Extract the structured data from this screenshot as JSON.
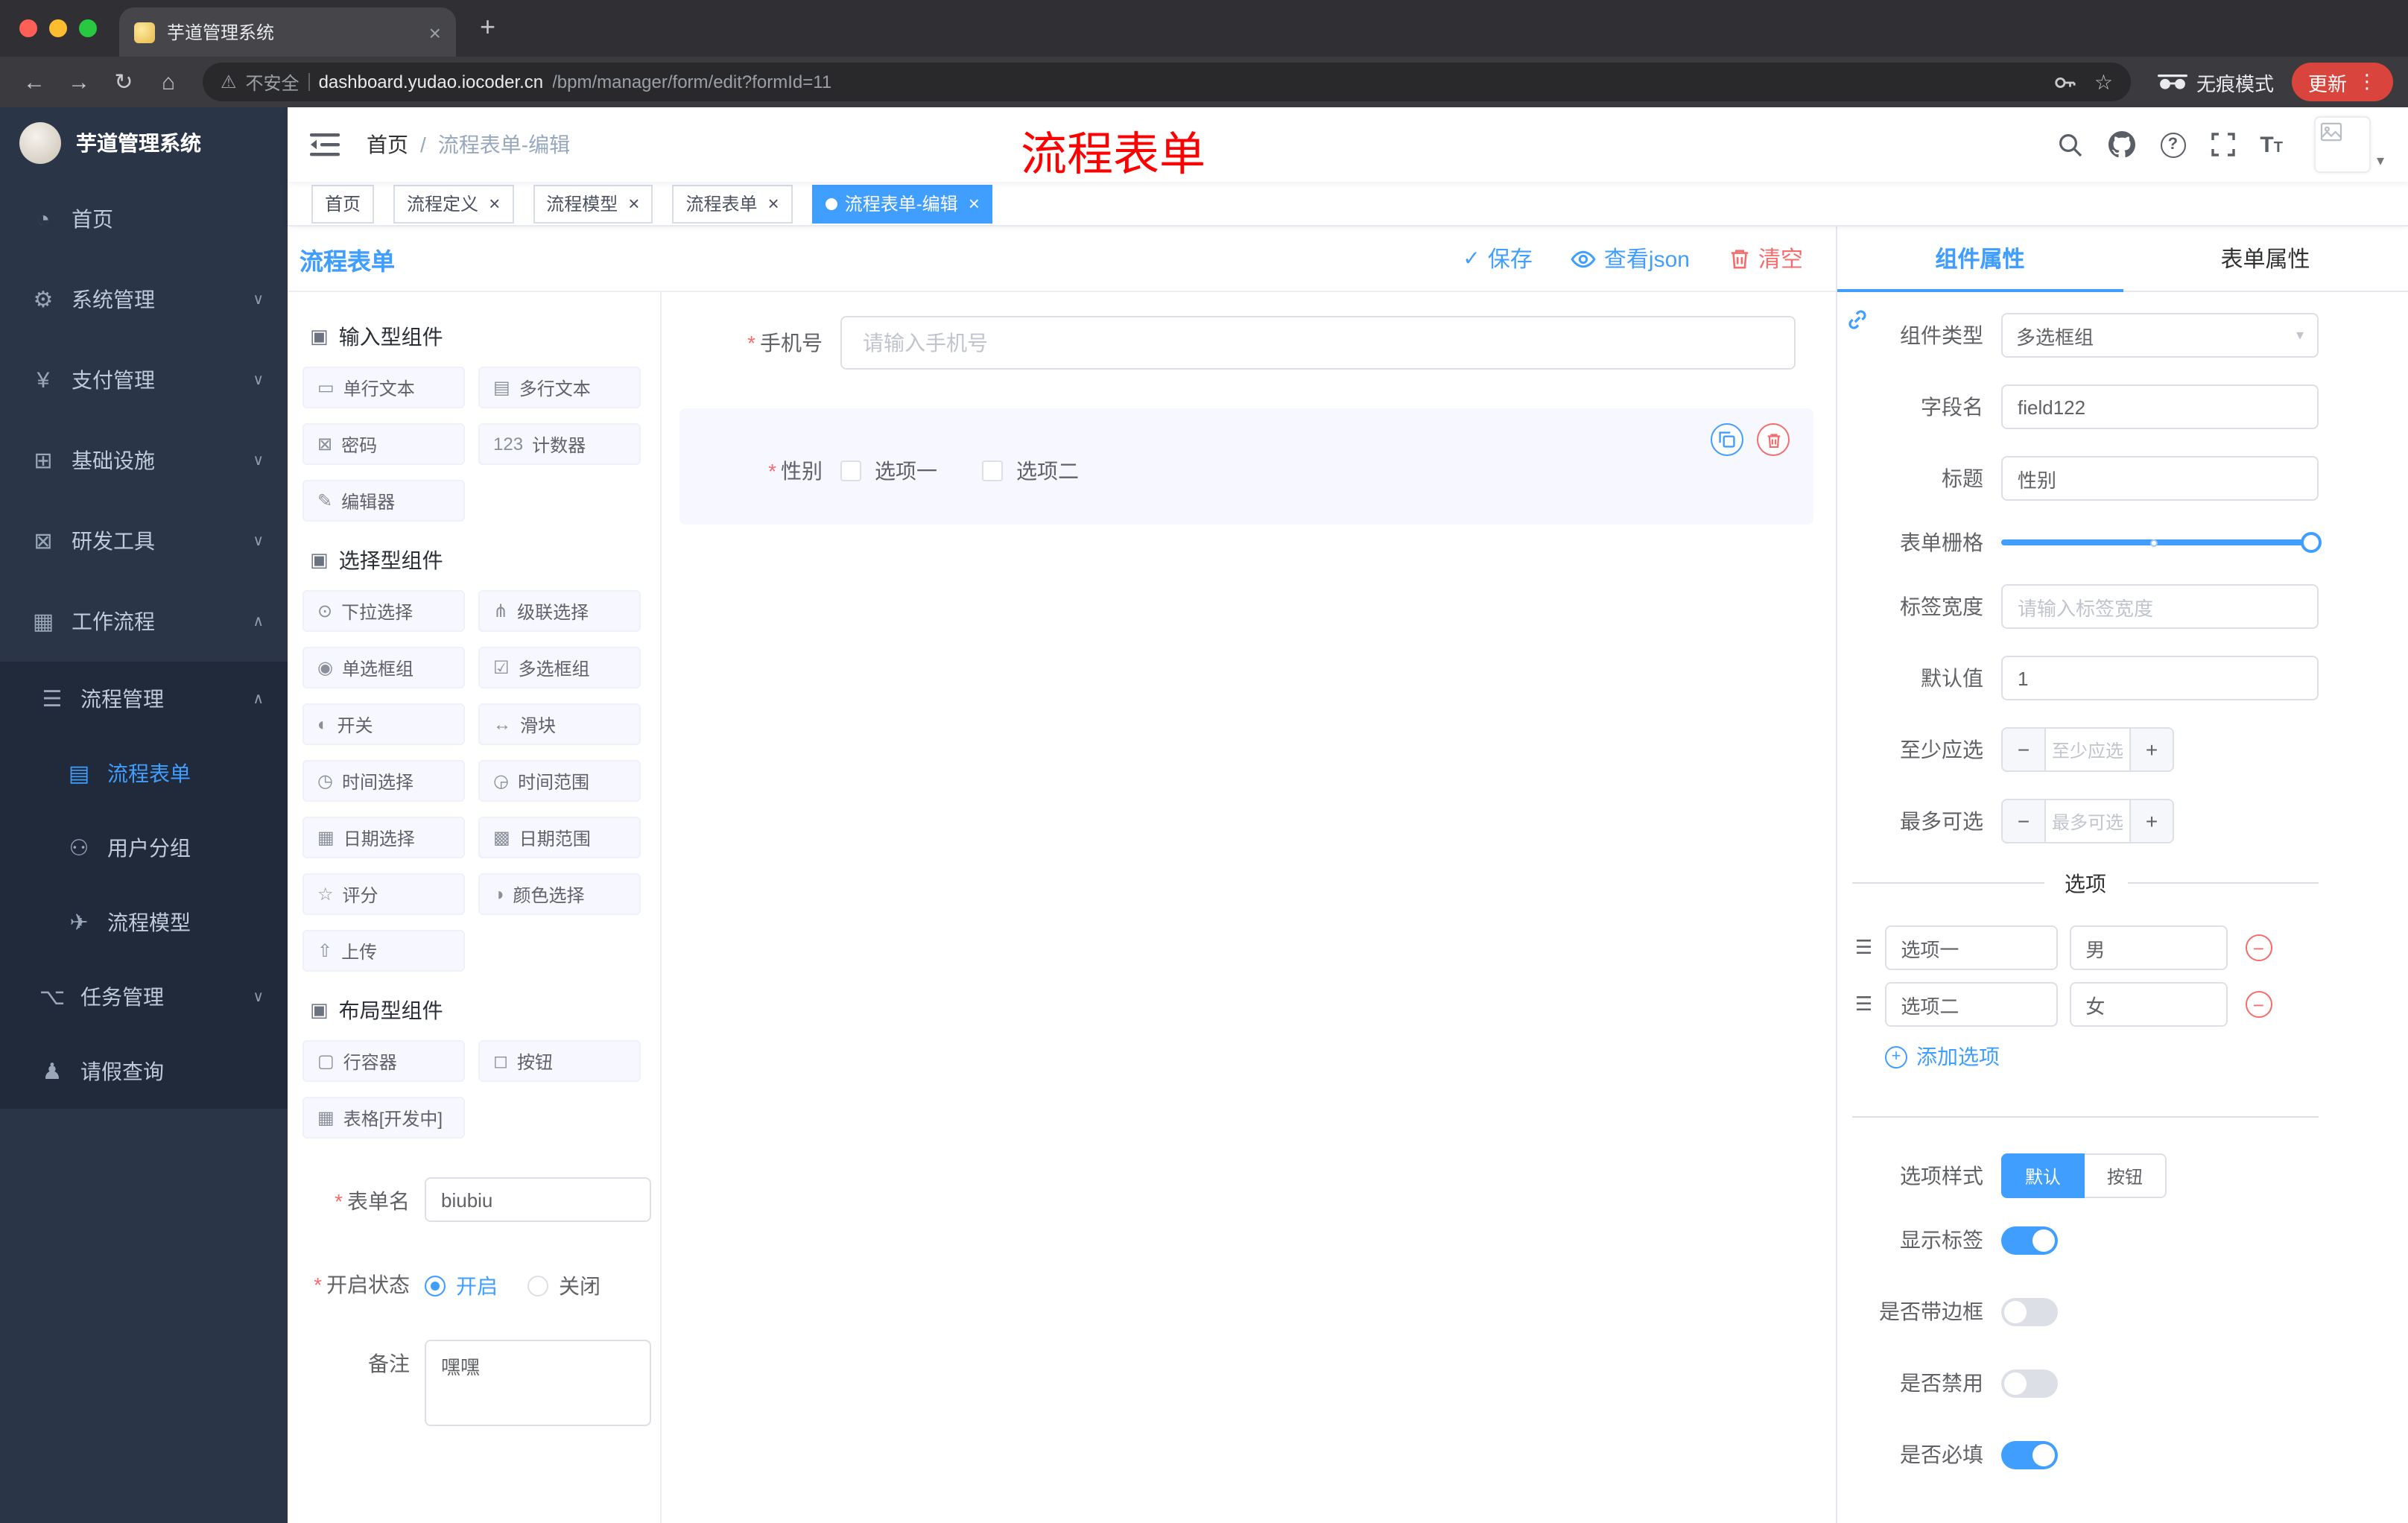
{
  "browser": {
    "tab_title": "芋道管理系统",
    "security_label": "不安全",
    "url_host": "dashboard.yudao.iocoder.cn",
    "url_path": "/bpm/manager/form/edit?formId=11",
    "incognito_label": "无痕模式",
    "update_label": "更新"
  },
  "sidebar": {
    "logo_title": "芋道管理系统",
    "items": [
      {
        "label": "首页",
        "glyph": "◔",
        "arrow": "",
        "cls": "lvl0"
      },
      {
        "label": "系统管理",
        "glyph": "⚙",
        "arrow": "∨",
        "cls": "lvl0"
      },
      {
        "label": "支付管理",
        "glyph": "¥",
        "arrow": "∨",
        "cls": "lvl0"
      },
      {
        "label": "基础设施",
        "glyph": "⊞",
        "arrow": "∨",
        "cls": "lvl0"
      },
      {
        "label": "研发工具",
        "glyph": "⊠",
        "arrow": "∨",
        "cls": "lvl0"
      },
      {
        "label": "工作流程",
        "glyph": "▦",
        "arrow": "∧",
        "cls": "lvl0"
      },
      {
        "label": "流程管理",
        "glyph": "☰",
        "arrow": "∧",
        "cls": "lvl1 sub"
      },
      {
        "label": "流程表单",
        "glyph": "▤",
        "arrow": "",
        "cls": "lvl2 sub active"
      },
      {
        "label": "用户分组",
        "glyph": "⚇",
        "arrow": "",
        "cls": "lvl2 sub"
      },
      {
        "label": "流程模型",
        "glyph": "✈",
        "arrow": "",
        "cls": "lvl2 sub"
      },
      {
        "label": "任务管理",
        "glyph": "⌥",
        "arrow": "∨",
        "cls": "lvl1 sub"
      },
      {
        "label": "请假查询",
        "glyph": "♟",
        "arrow": "",
        "cls": "lvl1 sub"
      }
    ]
  },
  "navbar": {
    "breadcrumb_home": "首页",
    "breadcrumb_current": "流程表单-编辑",
    "annotation": "流程表单"
  },
  "tags": [
    {
      "label": "首页",
      "cls": ""
    },
    {
      "label": "流程定义",
      "cls": "closable"
    },
    {
      "label": "流程模型",
      "cls": "closable"
    },
    {
      "label": "流程表单",
      "cls": "closable"
    },
    {
      "label": "流程表单-编辑",
      "cls": "closable active"
    }
  ],
  "designer": {
    "title": "流程表单",
    "save_label": "保存",
    "view_json_label": "查看json",
    "clear_label": "清空"
  },
  "components_panel": {
    "sections": [
      {
        "title": "输入型组件",
        "items": [
          {
            "label": "单行文本",
            "glyph": "▭"
          },
          {
            "label": "多行文本",
            "glyph": "▤"
          },
          {
            "label": "密码",
            "glyph": "⊠"
          },
          {
            "label": "计数器",
            "glyph": "123"
          },
          {
            "label": "编辑器",
            "glyph": "✎"
          }
        ]
      },
      {
        "title": "选择型组件",
        "items": [
          {
            "label": "下拉选择",
            "glyph": "⊙"
          },
          {
            "label": "级联选择",
            "glyph": "⋔"
          },
          {
            "label": "单选框组",
            "glyph": "◉"
          },
          {
            "label": "多选框组",
            "glyph": "☑"
          },
          {
            "label": "开关",
            "glyph": "◐"
          },
          {
            "label": "滑块",
            "glyph": "↔"
          },
          {
            "label": "时间选择",
            "glyph": "◷"
          },
          {
            "label": "时间范围",
            "glyph": "◶"
          },
          {
            "label": "日期选择",
            "glyph": "▦"
          },
          {
            "label": "日期范围",
            "glyph": "▩"
          },
          {
            "label": "评分",
            "glyph": "☆"
          },
          {
            "label": "颜色选择",
            "glyph": "◑"
          },
          {
            "label": "上传",
            "glyph": "⇧"
          }
        ]
      },
      {
        "title": "布局型组件",
        "items": [
          {
            "label": "行容器",
            "glyph": "▢"
          },
          {
            "label": "按钮",
            "glyph": "◻"
          },
          {
            "label": "表格[开发中]",
            "glyph": "▦"
          }
        ]
      }
    ],
    "form": {
      "name_label": "表单名",
      "name_value": "biubiu",
      "status_label": "开启状态",
      "status_on": "开启",
      "status_off": "关闭",
      "remark_label": "备注",
      "remark_value": "嘿嘿"
    }
  },
  "canvas": {
    "phone": {
      "label": "手机号",
      "placeholder": "请输入手机号"
    },
    "gender": {
      "label": "性别",
      "options": [
        "选项一",
        "选项二"
      ]
    }
  },
  "props_panel": {
    "tabs": [
      {
        "label": "组件属性",
        "cls": "active"
      },
      {
        "label": "表单属性",
        "cls": ""
      }
    ],
    "rows": {
      "type_label": "组件类型",
      "type_value": "多选框组",
      "field_label": "字段名",
      "field_value": "field122",
      "title_label": "标题",
      "title_value": "性别",
      "grid_label": "表单栅格",
      "labelwidth_label": "标签宽度",
      "labelwidth_placeholder": "请输入标签宽度",
      "default_label": "默认值",
      "default_value": "1",
      "min_label": "至少应选",
      "min_placeholder": "至少应选",
      "max_label": "最多可选",
      "max_placeholder": "最多可选"
    },
    "options_divider": "选项",
    "options": [
      {
        "name": "选项一",
        "value": "男"
      },
      {
        "name": "选项二",
        "value": "女"
      }
    ],
    "add_option": "添加选项",
    "style_label": "选项样式",
    "style_default": "默认",
    "style_button": "按钮",
    "toggles": [
      {
        "label": "显示标签",
        "on": true
      },
      {
        "label": "是否带边框",
        "on": false
      },
      {
        "label": "是否禁用",
        "on": false
      },
      {
        "label": "是否必填",
        "on": true
      }
    ]
  },
  "colors": {
    "primary": "#409eff",
    "danger": "#f56c6c",
    "annotation_red": "#ff0000",
    "sidebar_bg": "#2a3547",
    "sidebar_sub_bg": "#202a3a",
    "selected_row_bg": "#f6f7ff"
  }
}
